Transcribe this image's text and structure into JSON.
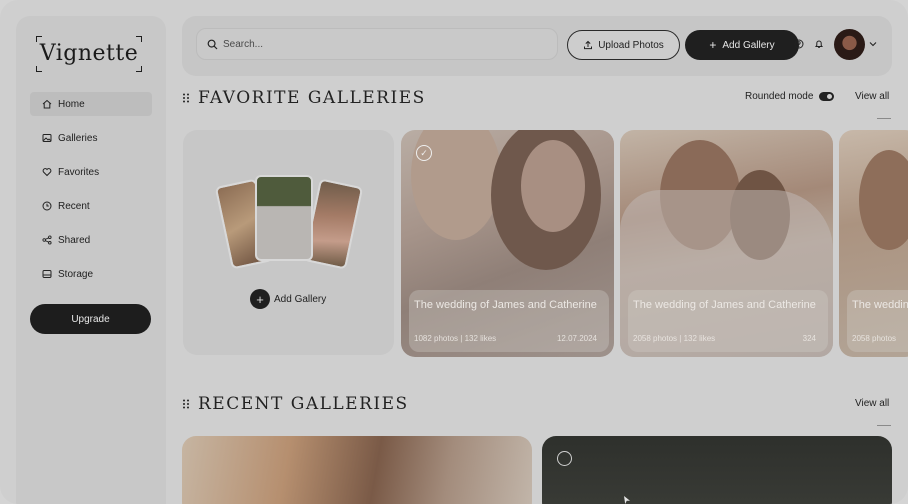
{
  "app": {
    "logo_text": "Vignette"
  },
  "sidebar": {
    "items": [
      {
        "label": "Home",
        "icon": "home-icon",
        "active": true
      },
      {
        "label": "Galleries",
        "icon": "image-icon",
        "active": false
      },
      {
        "label": "Favorites",
        "icon": "heart-icon",
        "active": false
      },
      {
        "label": "Recent",
        "icon": "clock-icon",
        "active": false
      },
      {
        "label": "Shared",
        "icon": "share-icon",
        "active": false
      },
      {
        "label": "Storage",
        "icon": "storage-icon",
        "active": false
      }
    ],
    "upgrade_label": "Upgrade"
  },
  "topbar": {
    "search_placeholder": "Search...",
    "upload_label": "Upload Photos",
    "add_gallery_label": "Add Gallery",
    "add_gallery_plus": "+"
  },
  "favorites": {
    "title": "FAVORITE GALLERIES",
    "rounded_mode_label": "Rounded mode",
    "view_all_label": "View all",
    "add_card_label": "Add Gallery",
    "add_card_plus": "+",
    "cards": [
      {
        "title": "The wedding of James and Catherine",
        "meta": "1082 photos | 132 likes",
        "date": "12.07.2024",
        "selected": true
      },
      {
        "title": "The wedding of James and Catherine",
        "meta": "2058 photos | 132 likes",
        "date": "324"
      },
      {
        "title": "The wedding",
        "meta": "2058 photos"
      }
    ]
  },
  "recent": {
    "title": "RECENT GALLERIES",
    "view_all_label": "View all"
  },
  "colors": {
    "accent_dark": "#1f1f1f",
    "surface": "#c8c8c8",
    "background": "#cfcfcf"
  }
}
